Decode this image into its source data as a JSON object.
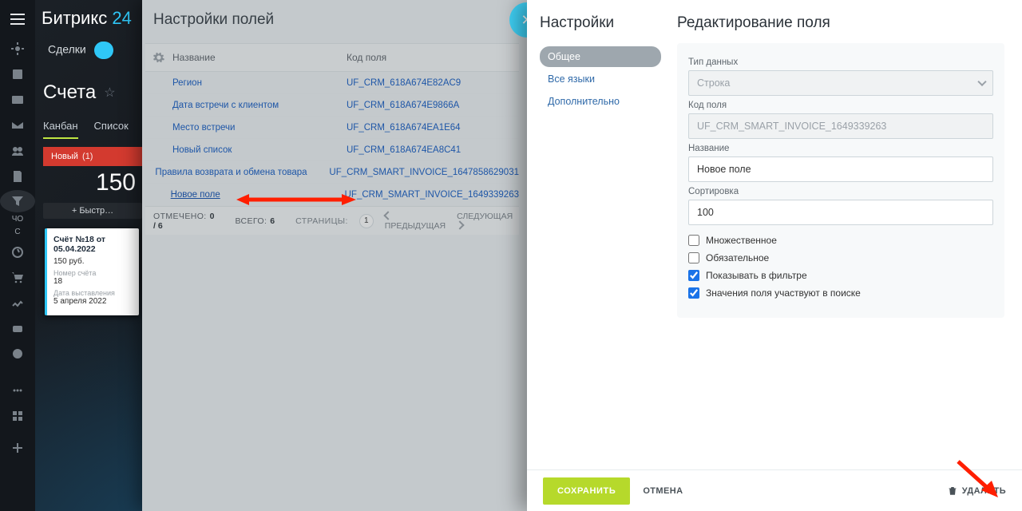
{
  "brand": {
    "a": "Битрикс",
    "b": "24"
  },
  "topnav": {
    "deals": "Сделки"
  },
  "page": {
    "title": "Счета",
    "searchPlaceholder": "",
    "subtabs": {
      "kanban": "Канбан",
      "list": "Список"
    },
    "stage": {
      "name": "Новый",
      "count": "(1)"
    },
    "amount": "150",
    "quick": "+  Быстр…"
  },
  "card": {
    "title": "Счёт №18 от 05.04.2022",
    "price": "150 руб.",
    "numLabel": "Номер счёта",
    "num": "18",
    "dateLabel": "Дата выставления",
    "date": "5 апреля 2022"
  },
  "rail": {
    "cho": "ЧО",
    "s": "С"
  },
  "fields": {
    "title": "Настройки полей",
    "colName": "Название",
    "colCode": "Код поля",
    "rows": [
      {
        "name": "Регион",
        "code": "UF_CRM_618A674E82AC9"
      },
      {
        "name": "Дата встречи с клиентом",
        "code": "UF_CRM_618A674E9866A"
      },
      {
        "name": "Место встречи",
        "code": "UF_CRM_618A674EA1E64"
      },
      {
        "name": "Новый список",
        "code": "UF_CRM_618A674EA8C41"
      },
      {
        "name": "Правила возврата и обмена товара",
        "code": "UF_CRM_SMART_INVOICE_1647858629031"
      },
      {
        "name": "Новое поле",
        "code": "UF_CRM_SMART_INVOICE_1649339263"
      }
    ],
    "footer": {
      "selectedLabel": "ОТМЕЧЕНО:",
      "selectedValue": "0 / 6",
      "totalLabel": "ВСЕГО:",
      "totalValue": "6",
      "pagesLabel": "СТРАНИЦЫ:",
      "page": "1",
      "prev": "ПРЕДЫДУЩАЯ",
      "next": "СЛЕДУЮЩАЯ"
    }
  },
  "edit": {
    "navTitle": "Настройки",
    "navItems": {
      "common": "Общее",
      "langs": "Все языки",
      "extra": "Дополнительно"
    },
    "formTitle": "Редактирование поля",
    "labels": {
      "type": "Тип данных",
      "code": "Код поля",
      "name": "Название",
      "sort": "Сортировка",
      "multi": "Множественное",
      "required": "Обязательное",
      "filter": "Показывать в фильтре",
      "search": "Значения поля участвуют в поиске"
    },
    "values": {
      "type": "Строка",
      "code": "UF_CRM_SMART_INVOICE_1649339263",
      "name": "Новое поле",
      "sort": "100",
      "multi": false,
      "required": false,
      "filter": true,
      "search": true
    },
    "buttons": {
      "save": "СОХРАНИТЬ",
      "cancel": "ОТМЕНА",
      "del": "УДАЛИТЬ"
    }
  }
}
